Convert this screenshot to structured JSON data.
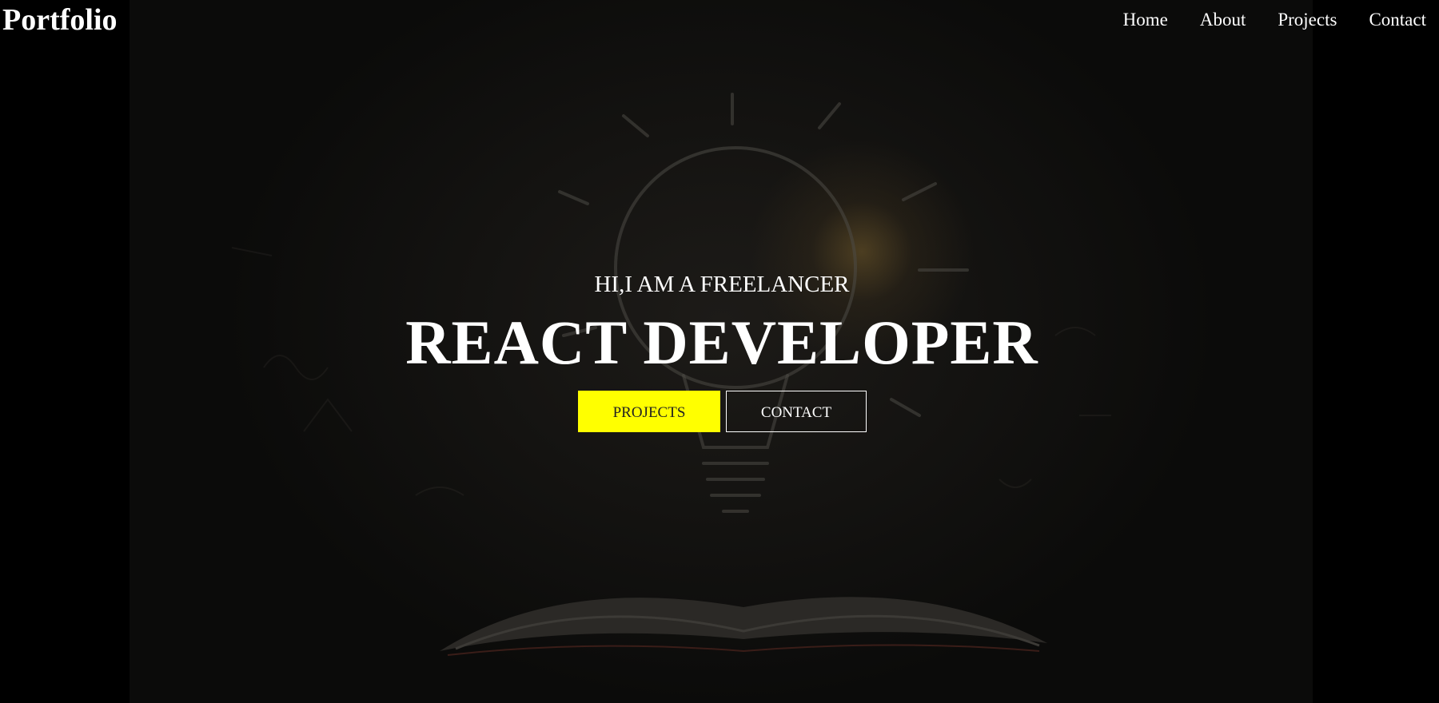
{
  "navbar": {
    "brand": "Portfolio",
    "links": [
      {
        "label": "Home"
      },
      {
        "label": "About"
      },
      {
        "label": "Projects"
      },
      {
        "label": "Contact"
      }
    ]
  },
  "hero": {
    "subtitle": "HI,I AM A FREELANCER",
    "headline": "REACT DEVELOPER",
    "buttons": {
      "projects_label": "PROJECTS",
      "contact_label": "CONTACT"
    },
    "background_image": "lightbulb-over-open-book-illustration"
  },
  "colors": {
    "page_background": "#000000",
    "accent": "#ffff00",
    "text": "#ffffff"
  }
}
